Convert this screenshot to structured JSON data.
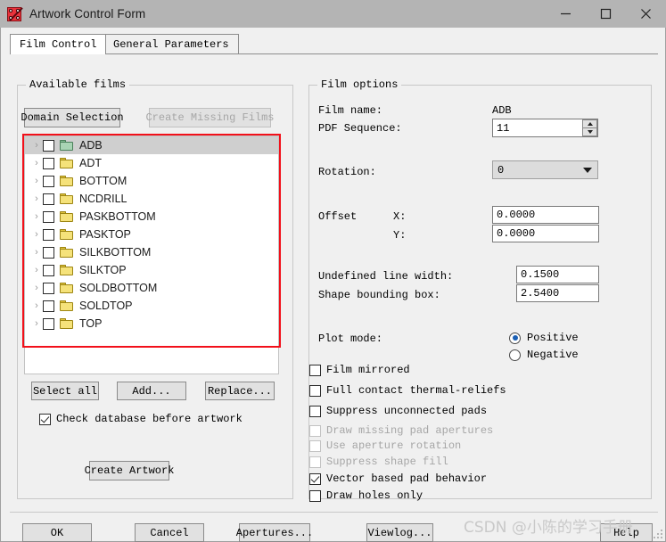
{
  "window": {
    "title": "Artwork Control Form",
    "icon": "artwork-app-icon",
    "controls": {
      "minimize": "minimize-icon",
      "maximize": "maximize-icon",
      "close": "close-icon"
    }
  },
  "tabs": [
    {
      "label": "Film Control",
      "active": true
    },
    {
      "label": "General Parameters",
      "active": false
    }
  ],
  "films_group": {
    "title": "Available films",
    "domain_selection_label": "Domain Selection",
    "create_missing_films_label": "Create Missing Films",
    "create_missing_films_enabled": false,
    "tree": [
      {
        "label": "ADB",
        "folder_color": "#a8d4b4",
        "selected": true,
        "checked": false,
        "expandable": true
      },
      {
        "label": "ADT",
        "folder_color": "#f5e27a",
        "selected": false,
        "checked": false,
        "expandable": true
      },
      {
        "label": "BOTTOM",
        "folder_color": "#f5e27a",
        "selected": false,
        "checked": false,
        "expandable": true
      },
      {
        "label": "NCDRILL",
        "folder_color": "#f5e27a",
        "selected": false,
        "checked": false,
        "expandable": true
      },
      {
        "label": "PASKBOTTOM",
        "folder_color": "#f5e27a",
        "selected": false,
        "checked": false,
        "expandable": true
      },
      {
        "label": "PASKTOP",
        "folder_color": "#f5e27a",
        "selected": false,
        "checked": false,
        "expandable": true
      },
      {
        "label": "SILKBOTTOM",
        "folder_color": "#f5e27a",
        "selected": false,
        "checked": false,
        "expandable": true
      },
      {
        "label": "SILKTOP",
        "folder_color": "#f5e27a",
        "selected": false,
        "checked": false,
        "expandable": true
      },
      {
        "label": "SOLDBOTTOM",
        "folder_color": "#f5e27a",
        "selected": false,
        "checked": false,
        "expandable": true
      },
      {
        "label": "SOLDTOP",
        "folder_color": "#f5e27a",
        "selected": false,
        "checked": false,
        "expandable": true
      },
      {
        "label": "TOP",
        "folder_color": "#f5e27a",
        "selected": false,
        "checked": false,
        "expandable": true
      }
    ],
    "select_all_label": "Select all",
    "add_label": "Add...",
    "replace_label": "Replace...",
    "check_database_label": "Check database before artwork",
    "check_database_checked": true,
    "create_artwork_label": "Create Artwork"
  },
  "film_options": {
    "title": "Film options",
    "film_name_label": "Film name:",
    "film_name_value": "ADB",
    "pdf_sequence_label": "PDF Sequence:",
    "pdf_sequence_value": "11",
    "rotation_label": "Rotation:",
    "rotation_value": "0",
    "offset_label": "Offset",
    "offset_x_label": "X:",
    "offset_x_value": "0.0000",
    "offset_y_label": "Y:",
    "offset_y_value": "0.0000",
    "undefined_line_width_label": "Undefined line width:",
    "undefined_line_width_value": "0.1500",
    "shape_bounding_box_label": "Shape bounding box:",
    "shape_bounding_box_value": "2.5400",
    "plot_mode_label": "Plot mode:",
    "plot_mode_options": [
      {
        "label": "Positive",
        "selected": true
      },
      {
        "label": "Negative",
        "selected": false
      }
    ],
    "checkboxes": [
      {
        "label": "Film mirrored",
        "checked": false,
        "enabled": true
      },
      {
        "label": "Full contact thermal-reliefs",
        "checked": false,
        "enabled": true
      },
      {
        "label": "Suppress unconnected pads",
        "checked": false,
        "enabled": true
      },
      {
        "label": "Draw missing pad apertures",
        "checked": false,
        "enabled": false
      },
      {
        "label": "Use aperture rotation",
        "checked": false,
        "enabled": false
      },
      {
        "label": "Suppress shape fill",
        "checked": false,
        "enabled": false
      },
      {
        "label": "Vector based pad behavior",
        "checked": true,
        "enabled": true
      },
      {
        "label": "Draw holes only",
        "checked": false,
        "enabled": true
      }
    ]
  },
  "footer": {
    "ok_label": "OK",
    "cancel_label": "Cancel",
    "apertures_label": "Apertures...",
    "viewlog_label": "Viewlog...",
    "help_label": "Help"
  },
  "watermark": "CSDN @小陈的学习手册",
  "colors": {
    "accent_radio": "#1a5fb4",
    "annotation_rect": "#f2101a",
    "titlebar": "#b4b4b4",
    "dialog_bg": "#f0f0f0"
  }
}
